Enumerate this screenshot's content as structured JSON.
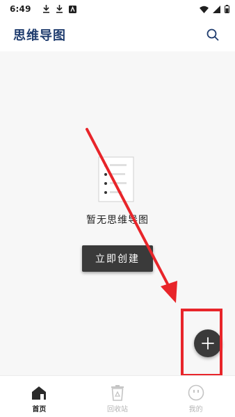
{
  "status_bar": {
    "time": "6:49",
    "left_icons": [
      "download-icon",
      "download-icon",
      "app-notification-icon"
    ],
    "right_icons": [
      "wifi-icon",
      "signal-icon",
      "battery-icon"
    ]
  },
  "app_bar": {
    "title": "思维导图",
    "title_color": "#1f3c6e",
    "search_icon": "search-icon"
  },
  "empty_state": {
    "illustration": "document-list-icon",
    "text": "暂无思维导图",
    "create_button_label": "立即创建"
  },
  "fab": {
    "icon": "plus-icon"
  },
  "annotation": {
    "arrow_color": "#e8252a",
    "highlight_color": "#e8252a"
  },
  "bottom_nav": {
    "items": [
      {
        "label": "首页",
        "icon": "home-icon",
        "active": true
      },
      {
        "label": "回收站",
        "icon": "recycle-bin-icon",
        "active": false
      },
      {
        "label": "我的",
        "icon": "profile-icon",
        "active": false
      }
    ]
  }
}
